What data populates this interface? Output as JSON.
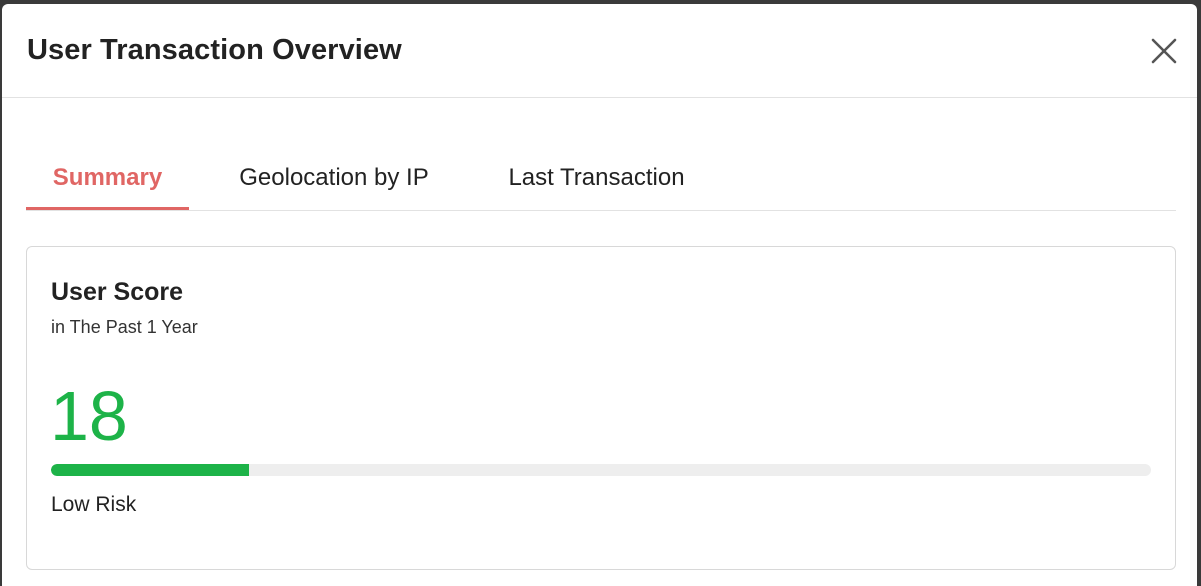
{
  "dialog": {
    "title": "User Transaction Overview",
    "close_icon": "close-icon"
  },
  "tabs": [
    {
      "label": "Summary",
      "active": true
    },
    {
      "label": "Geolocation by IP",
      "active": false
    },
    {
      "label": "Last Transaction",
      "active": false
    }
  ],
  "score_card": {
    "title": "User Score",
    "subtitle": "in The Past 1 Year",
    "score": "18",
    "score_bar_fraction": 0.18,
    "risk_label": "Low Risk"
  },
  "colors": {
    "accent": "#e06664",
    "score_green": "#1db348",
    "track": "#eeeeee"
  }
}
